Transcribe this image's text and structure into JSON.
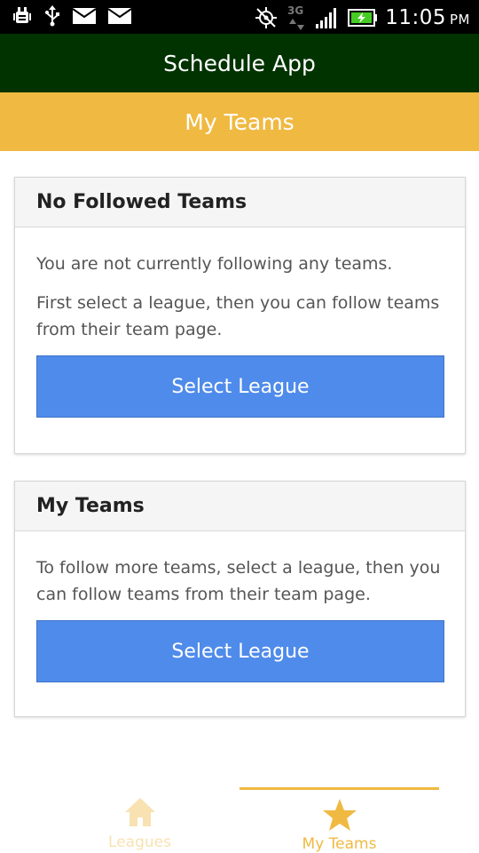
{
  "status_bar": {
    "time": "11:05",
    "ampm": "PM",
    "network": "3G",
    "icons": [
      "android-debug-icon",
      "usb-icon",
      "mail-icon",
      "mail-icon",
      "gps-off-icon",
      "data-3g-icon",
      "signal-icon",
      "battery-charging-icon"
    ]
  },
  "app_bar": {
    "title": "Schedule App"
  },
  "sub_header": {
    "title": "My Teams"
  },
  "cards": [
    {
      "title": "No Followed Teams",
      "paragraphs": [
        "You are not currently following any teams.",
        "First select a league, then you can follow teams from their team page."
      ],
      "button_label": "Select League"
    },
    {
      "title": "My Teams",
      "paragraphs": [
        "To follow more teams, select a league, then you can follow teams from their team page."
      ],
      "button_label": "Select League"
    }
  ],
  "bottom_nav": {
    "items": [
      {
        "label": "Leagues",
        "icon": "home-icon",
        "active": false
      },
      {
        "label": "My Teams",
        "icon": "star-icon",
        "active": true
      }
    ]
  },
  "colors": {
    "app_bar": "#003300",
    "accent": "#f0b942",
    "button": "#4f8bea",
    "status_bar": "#000000"
  }
}
